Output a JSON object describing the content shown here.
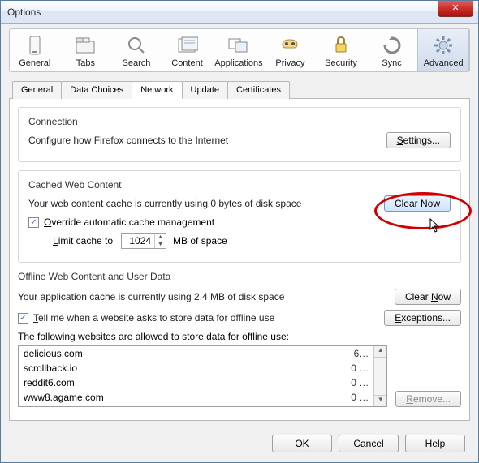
{
  "window": {
    "title": "Options",
    "close": "✕"
  },
  "toolbar": [
    {
      "label": "General"
    },
    {
      "label": "Tabs"
    },
    {
      "label": "Search"
    },
    {
      "label": "Content"
    },
    {
      "label": "Applications"
    },
    {
      "label": "Privacy"
    },
    {
      "label": "Security"
    },
    {
      "label": "Sync"
    },
    {
      "label": "Advanced"
    }
  ],
  "tabs": [
    {
      "label": "General"
    },
    {
      "label": "Data Choices"
    },
    {
      "label": "Network"
    },
    {
      "label": "Update"
    },
    {
      "label": "Certificates"
    }
  ],
  "connection": {
    "title": "Connection",
    "desc": "Configure how Firefox connects to the Internet",
    "settings_btn": "Settings..."
  },
  "cached": {
    "title": "Cached Web Content",
    "usage": "Your web content cache is currently using 0 bytes of disk space",
    "clear_btn": "Clear Now",
    "override_label_pre": "O",
    "override_label": "verride automatic cache management",
    "limit_pre": "L",
    "limit_label": "imit cache to",
    "limit_value": "1024",
    "limit_suffix": "MB of space"
  },
  "offline": {
    "title": "Offline Web Content and User Data",
    "usage": "Your application cache is currently using 2.4 MB of disk space",
    "clear_btn": "Clear Now",
    "tell_pre": "T",
    "tell_label": "ell me when a website asks to store data for offline use",
    "exceptions_btn": "Exceptions...",
    "allowed_label": "The following websites are allowed to store data for offline use:",
    "sites": [
      {
        "host": "delicious.com",
        "size": "6…"
      },
      {
        "host": "scrollback.io",
        "size": "0 …"
      },
      {
        "host": "reddit6.com",
        "size": "0 …"
      },
      {
        "host": "www8.agame.com",
        "size": "0 …"
      }
    ],
    "remove_pre": "R",
    "remove_btn": "emove..."
  },
  "buttons": {
    "ok": "OK",
    "cancel": "Cancel",
    "help_pre": "H",
    "help": "elp"
  }
}
